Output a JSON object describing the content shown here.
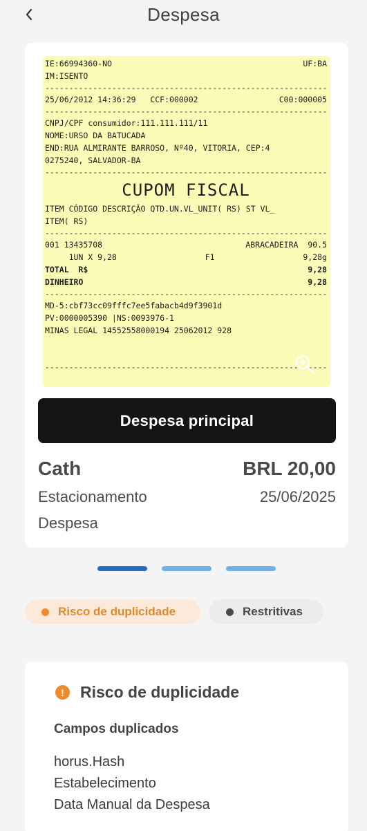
{
  "header": {
    "title": "Despesa",
    "back_icon": "chevron-left-icon"
  },
  "receipt": {
    "l01_left": "IE:66994360-NO",
    "l01_right": "UF:BA",
    "l02": "IM:ISENTO",
    "l03_left": "25/06/2012 14:36:29   CCF:000002",
    "l03_right": "C00:000005",
    "l04": "CNPJ/CPF consumidor:111.111.111/11",
    "l05": "NOME:URSO DA BATUCADA",
    "l06": "END:RUA ALMIRANTE BARROSO, Nº40, VITORIA, CEP:4",
    "l07": "0275240, SALVADOR-BA",
    "l08": "CUPOM FISCAL",
    "l09": "ITEM CÓDIGO DESCRIÇÃO QTD.UN.VL_UNIT( RS) ST VL_",
    "l10": "ITEM( RS)",
    "l11_left": "001 13435708",
    "l11_right": "ABRACADEIRA  90.5",
    "l12_left": "     1UN X 9,28",
    "l12_mid": "F1",
    "l12_right": "9,28g",
    "l13_left": "TOTAL  R$",
    "l13_right": "9,28",
    "l14_left": "DINHEIRO",
    "l14_right": "9,28",
    "l15": "MD-5:cbf73cc09fffc7ee5fabacb4d9f3901d",
    "l16": "PV:0000005390 |NS:0093976-1",
    "l17": "MINAS LEGAL 14552558000194 25062012 928",
    "dashes": "----------------------------------------------------------------------",
    "zoom_icon": "zoom-in-icon"
  },
  "primary_button": "Despesa principal",
  "expense": {
    "name": "Cath",
    "amount": "BRL 20,00",
    "category": "Estacionamento",
    "date": "25/06/2025",
    "type": "Despesa"
  },
  "tags": [
    {
      "label": "Risco de duplicidade",
      "color": "#ef8a2c"
    },
    {
      "label": "Restritivas",
      "color": "#4a4a4a"
    }
  ],
  "risk_card": {
    "icon": "warning-icon",
    "title": "Risco de duplicidade",
    "subtitle": "Campos duplicados",
    "fields": [
      "horus.Hash",
      "Estabelecimento",
      "Data Manual da Despesa"
    ]
  },
  "colors": {
    "accent": "#ef8a2c",
    "pager_active": "#1e6fc2",
    "pager_inactive": "#6cb1ea",
    "primary_button": "#141414",
    "receipt_bg": "#fbfbb8"
  }
}
